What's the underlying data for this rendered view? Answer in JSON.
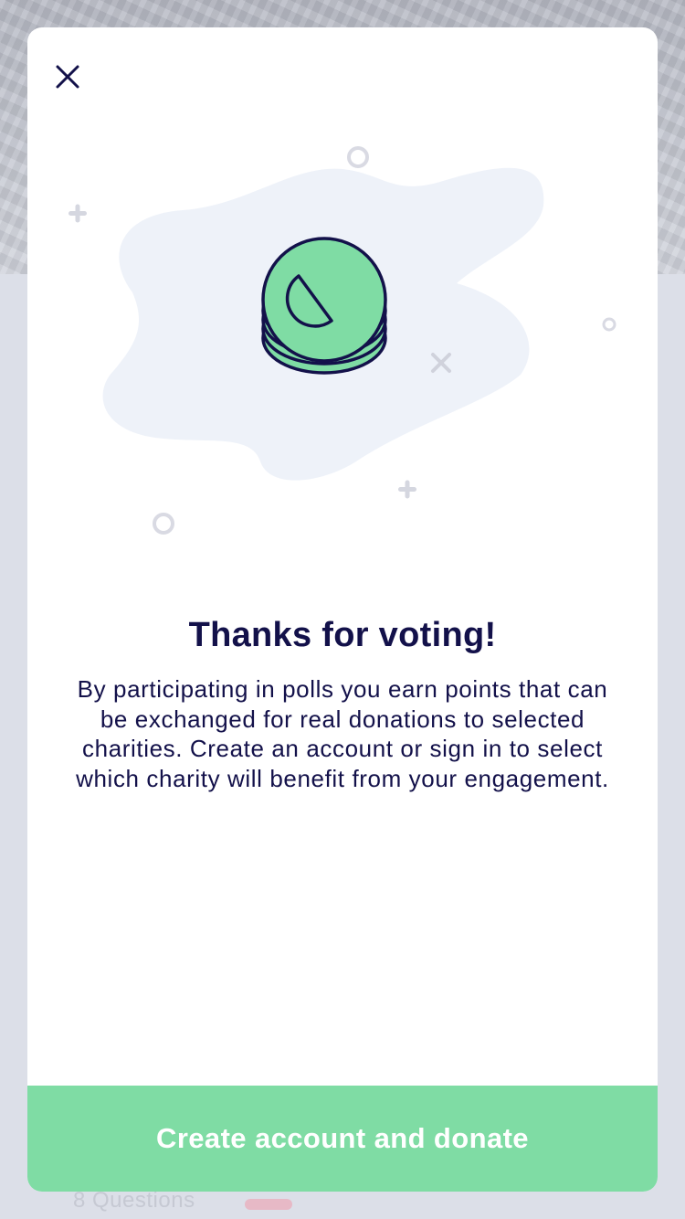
{
  "background": {
    "footer_label": "8 Questions"
  },
  "modal": {
    "close_icon": "close-icon",
    "illustration_icon": "coin-stack-icon",
    "title": "Thanks for voting!",
    "body": "By participating in polls you earn points that can be exchanged for real donations to selected charities. Create an account or sign in to select which charity will benefit from your engagement.",
    "cta_label": "Create account and donate"
  },
  "colors": {
    "primary_text": "#13114a",
    "accent_green": "#7fdca4",
    "blob": "#eef2f9",
    "decor_gray": "#d9dae3"
  }
}
